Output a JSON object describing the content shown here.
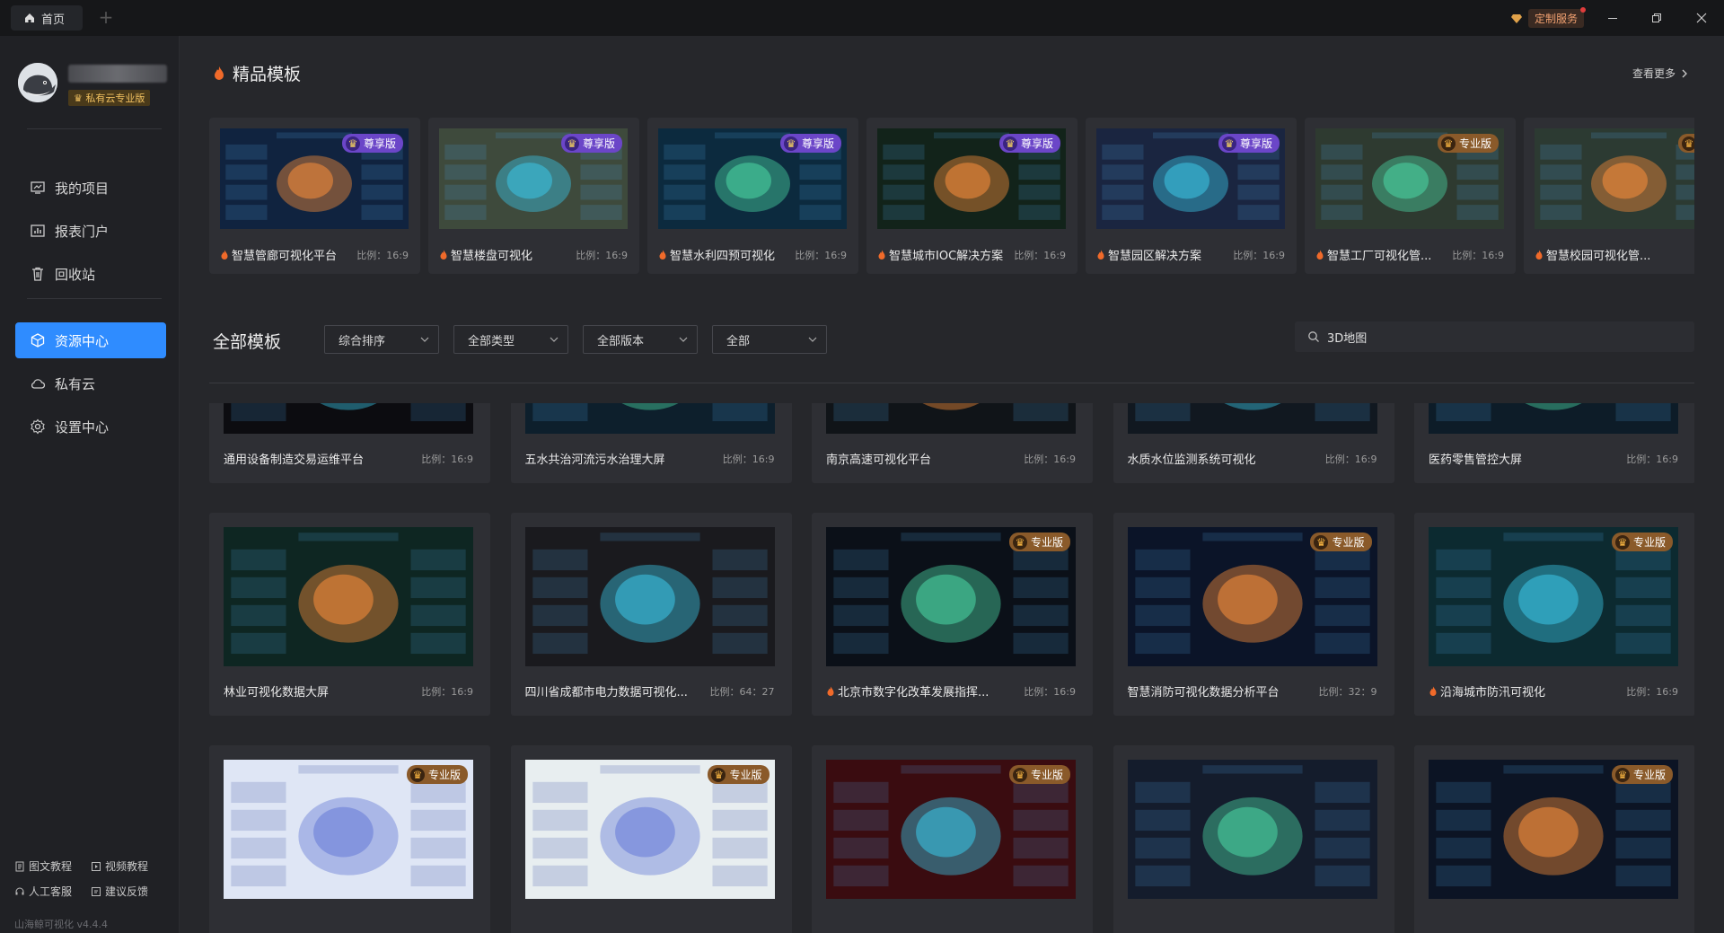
{
  "titlebar": {
    "home_tab": "首页",
    "add_tab": "+",
    "custom_service": "定制服务"
  },
  "sidebar": {
    "badge": "私有云专业版",
    "nav": [
      {
        "label": "我的项目",
        "icon": "monitor-icon"
      },
      {
        "label": "报表门户",
        "icon": "chart-icon"
      },
      {
        "label": "回收站",
        "icon": "trash-icon"
      },
      {
        "label": "资源中心",
        "icon": "cube-icon",
        "active": true
      },
      {
        "label": "私有云",
        "icon": "cloud-icon"
      },
      {
        "label": "设置中心",
        "icon": "gear-icon"
      }
    ],
    "footer": {
      "doc_tutorial": "图文教程",
      "video_tutorial": "视频教程",
      "support": "人工客服",
      "feedback": "建议反馈"
    },
    "version": "山海鲸可视化 v4.4.4"
  },
  "premium": {
    "title": "精品模板",
    "see_more": "查看更多",
    "cards": [
      {
        "name": "智慧管廊可视化平台",
        "ratio": "比例：16:9",
        "tier": "尊享版",
        "tier_style": "purple",
        "hot": true,
        "thumb": "#10233f"
      },
      {
        "name": "智慧楼盘可视化",
        "ratio": "比例：16:9",
        "tier": "尊享版",
        "tier_style": "purple",
        "hot": true,
        "thumb": "#3e4a3c"
      },
      {
        "name": "智慧水利四预可视化",
        "ratio": "比例：16:9",
        "tier": "尊享版",
        "tier_style": "purple",
        "hot": true,
        "thumb": "#0c2a3e"
      },
      {
        "name": "智慧城市IOC解决方案",
        "ratio": "比例：16:9",
        "tier": "尊享版",
        "tier_style": "purple",
        "hot": true,
        "thumb": "#12231a"
      },
      {
        "name": "智慧园区解决方案",
        "ratio": "比例：16:9",
        "tier": "尊享版",
        "tier_style": "purple",
        "hot": true,
        "thumb": "#1a2540"
      },
      {
        "name": "智慧工厂可视化管...",
        "ratio": "比例：16:9",
        "tier": "专业版",
        "tier_style": "gold",
        "hot": true,
        "thumb": "#2e3a30"
      },
      {
        "name": "智慧校园可视化管...",
        "ratio": "比例",
        "tier": "专",
        "tier_style": "gold",
        "hot": true,
        "thumb": "#2c3a32"
      }
    ]
  },
  "all": {
    "title": "全部模板",
    "filters": [
      "综合排序",
      "全部类型",
      "全部版本",
      "全部"
    ],
    "search_value": "3D地图"
  },
  "grid": [
    {
      "name": "通用设备制造交易运维平台",
      "ratio": "比例：16:9",
      "hot": false,
      "tier": "",
      "thumb": "#0c0c10"
    },
    {
      "name": "五水共治河流污水治理大屏",
      "ratio": "比例：16:9",
      "hot": false,
      "tier": "",
      "thumb": "#0d1f2c"
    },
    {
      "name": "南京高速可视化平台",
      "ratio": "比例：16:9",
      "hot": false,
      "tier": "",
      "thumb": "#101418"
    },
    {
      "name": "水质水位监测系统可视化",
      "ratio": "比例：16:9",
      "hot": false,
      "tier": "",
      "thumb": "#111820"
    },
    {
      "name": "医药零售管控大屏",
      "ratio": "比例：16:9",
      "hot": false,
      "tier": "",
      "thumb": "#0d1c28"
    },
    {
      "name": "林业可视化数据大屏",
      "ratio": "比例：16:9",
      "hot": false,
      "tier": "",
      "thumb": "#0e2622"
    },
    {
      "name": "四川省成都市电力数据可视化...",
      "ratio": "比例：64：27",
      "hot": false,
      "tier": "",
      "thumb": "#1a1a1e"
    },
    {
      "name": "北京市数字化改革发展指挥...",
      "ratio": "比例：16:9",
      "hot": true,
      "tier": "专业版",
      "thumb": "#0b1018"
    },
    {
      "name": "智慧消防可视化数据分析平台",
      "ratio": "比例：32：9",
      "hot": false,
      "tier": "专业版",
      "thumb": "#0b1428"
    },
    {
      "name": "沿海城市防汛可视化",
      "ratio": "比例：16:9",
      "hot": true,
      "tier": "专业版",
      "thumb": "#0c2a30"
    },
    {
      "name": "",
      "ratio": "",
      "hot": false,
      "tier": "专业版",
      "thumb": "#dfe6f5"
    },
    {
      "name": "",
      "ratio": "",
      "hot": false,
      "tier": "专业版",
      "thumb": "#e8eef0"
    },
    {
      "name": "",
      "ratio": "",
      "hot": false,
      "tier": "专业版",
      "thumb": "#3a0c10"
    },
    {
      "name": "",
      "ratio": "",
      "hot": false,
      "tier": "",
      "thumb": "#141c2c"
    },
    {
      "name": "",
      "ratio": "",
      "hot": false,
      "tier": "专业版",
      "thumb": "#0c1424"
    }
  ]
}
